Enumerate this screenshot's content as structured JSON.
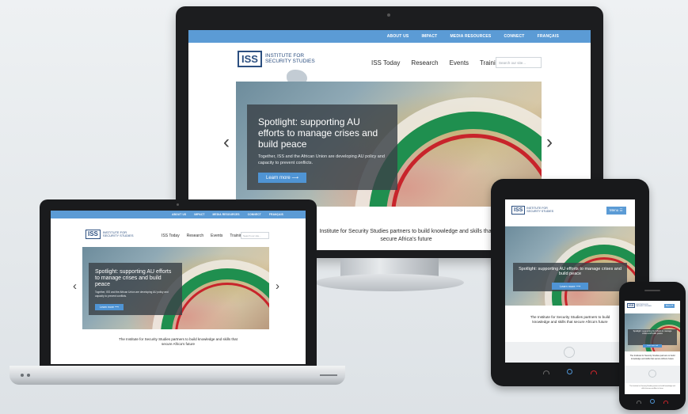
{
  "site": {
    "topnav": [
      "ABOUT US",
      "IMPACT",
      "MEDIA RESOURCES",
      "CONNECT",
      "FRANÇAIS"
    ],
    "logo_abbr": "ISS",
    "logo_line1": "INSTITUTE FOR",
    "logo_line2": "SECURITY STUDIES",
    "mainnav": [
      "ISS Today",
      "Research",
      "Events",
      "Training"
    ],
    "search_placeholder": "Search our site...",
    "hero_title": "Spotlight: supporting AU efforts to manage crises and build peace",
    "hero_body": "Together, ISS and the African Union are developing AU policy and capacity to prevent conflicts.",
    "learn_more": "Learn more ⟶",
    "tagline": "The Institute for Security Studies partners to build knowledge and skills that secure Africa’s future",
    "tagline_cut": "Institute for Security Studies partners to build knowledge and skills that secure Africa’s future",
    "menu_label": "Menu ☰",
    "prev_icon": "‹",
    "next_icon": "›"
  },
  "colors": {
    "topbar": "#5b9bd5",
    "brand": "#2c4f80",
    "button": "#4f94d4"
  }
}
